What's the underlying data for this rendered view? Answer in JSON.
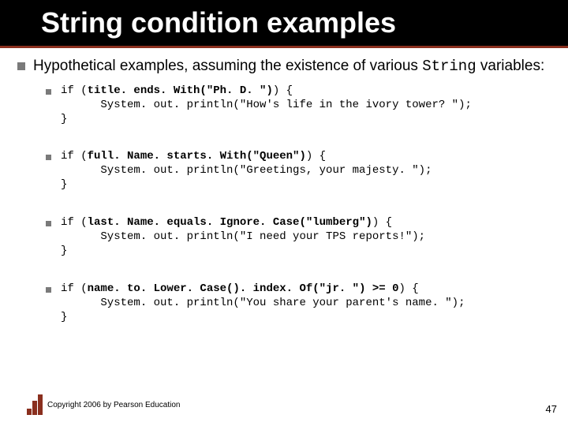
{
  "title": "String condition examples",
  "intro": {
    "pre_text": "Hypothetical examples, assuming the existence of various ",
    "mono_word": "String",
    "post_text": " variables:"
  },
  "code_examples": [
    {
      "line1_head": "if (",
      "line1_bold": "title. ends. With(\"Ph. D. \")",
      "line1_tail": ") {",
      "line2": "      System. out. println(\"How's life in the ivory tower? \");",
      "line3": "}"
    },
    {
      "line1_head": "if (",
      "line1_bold": "full. Name. starts. With(\"Queen\")",
      "line1_tail": ") {",
      "line2": "      System. out. println(\"Greetings, your majesty. \");",
      "line3": "}"
    },
    {
      "line1_head": "if (",
      "line1_bold": "last. Name. equals. Ignore. Case(\"lumberg\")",
      "line1_tail": ") {",
      "line2": "      System. out. println(\"I need your TPS reports!\");",
      "line3": "}"
    },
    {
      "line1_head": "if (",
      "line1_bold": "name. to. Lower. Case(). index. Of(\"jr. \") >= 0",
      "line1_tail": ") {",
      "line2": "      System. out. println(\"You share your parent's name. \");",
      "line3": "}"
    }
  ],
  "footer": "Copyright 2006 by Pearson Education",
  "page_number": "47",
  "icons": {
    "footer_icon": "stairs-icon"
  }
}
